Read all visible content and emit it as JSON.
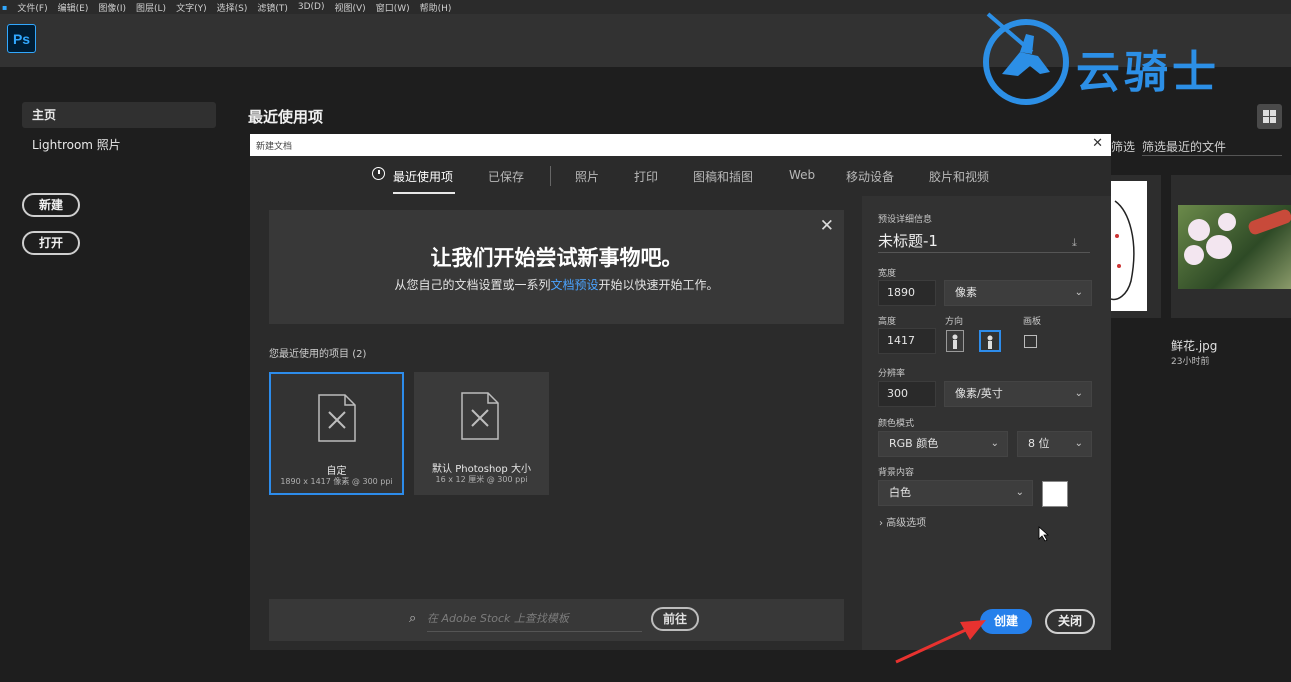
{
  "menu": [
    "文件(F)",
    "编辑(E)",
    "图像(I)",
    "图层(L)",
    "文字(Y)",
    "选择(S)",
    "滤镜(T)",
    "3D(D)",
    "视图(V)",
    "窗口(W)",
    "帮助(H)"
  ],
  "app_logo": "Ps",
  "sidebar": {
    "items": [
      {
        "label": "主页"
      },
      {
        "label": "Lightroom 照片"
      }
    ],
    "new_button": "新建",
    "open_button": "打开"
  },
  "home": {
    "title": "最近使用项",
    "filter_label": "筛选",
    "filter_placeholder": "筛选最近的文件",
    "file_name": "鲜花.jpg",
    "file_time": "23小时前"
  },
  "dialog": {
    "title": "新建文档",
    "tabs": [
      "最近使用项",
      "已保存",
      "照片",
      "打印",
      "图稿和插图",
      "Web",
      "移动设备",
      "胶片和视频"
    ],
    "active_tab": "最近使用项",
    "welcome_heading": "让我们开始尝试新事物吧。",
    "welcome_sub_pre": "从您自己的文档设置或一系列",
    "welcome_sub_link": "文档预设",
    "welcome_sub_post": "开始以快速开始工作。",
    "recent_label": "您最近使用的项目",
    "recent_count": "(2)",
    "cards": [
      {
        "name": "自定",
        "detail": "1890 x 1417 像素 @ 300 ppi",
        "selected": true
      },
      {
        "name": "默认 Photoshop 大小",
        "detail": "16 x 12 厘米 @ 300 ppi",
        "selected": false
      }
    ],
    "stock_placeholder": "在 Adobe Stock 上查找模板",
    "stock_go": "前往",
    "preset_details_label": "预设详细信息",
    "doc_name": "未标题-1",
    "width_label": "宽度",
    "width_value": "1890",
    "width_unit": "像素",
    "height_label": "高度",
    "height_value": "1417",
    "orientation_label": "方向",
    "artboard_label": "画板",
    "resolution_label": "分辨率",
    "resolution_value": "300",
    "resolution_unit": "像素/英寸",
    "color_mode_label": "颜色模式",
    "color_mode_value": "RGB 颜色",
    "bit_depth": "8 位",
    "background_label": "背景内容",
    "background_value": "白色",
    "background_swatch": "#ffffff",
    "advanced_label": "高级选项",
    "create_button": "创建",
    "close_button": "关闭"
  },
  "watermark": {
    "text": "云骑士"
  },
  "colors": {
    "accent": "#2680eb",
    "watermark": "#2c8fe6",
    "arrow": "#e8322f"
  }
}
